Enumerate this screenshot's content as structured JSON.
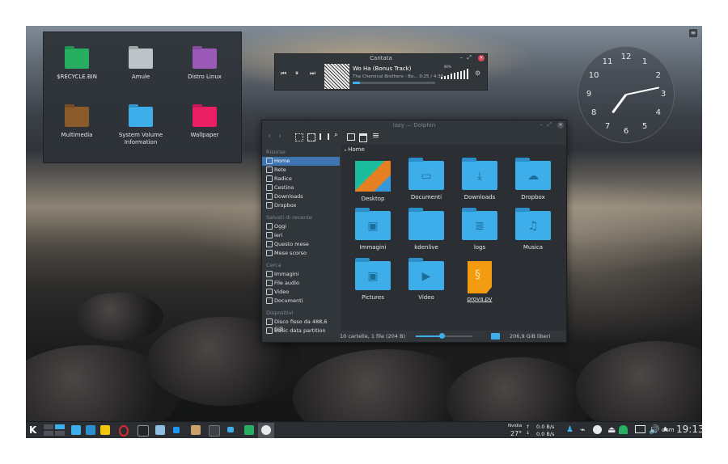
{
  "colors": {
    "accent": "#3daee9",
    "selection": "#3d74b1",
    "panel": "#2a2e32",
    "window": "#31363b"
  },
  "desktop": {
    "menu_icon": "hamburger-icon",
    "folder_view": {
      "items": [
        {
          "label": "$RECYCLE.BIN",
          "color": "#27ae60"
        },
        {
          "label": "Amule",
          "color": "#bdc3c7"
        },
        {
          "label": "Distro Linux",
          "color": "#9b59b6"
        },
        {
          "label": "Multimedia",
          "color": "#8b5a2b"
        },
        {
          "label": "System Volume Information",
          "color": "#3daee9"
        },
        {
          "label": "Wallpaper",
          "color": "#e91e63"
        }
      ]
    }
  },
  "player": {
    "title": "Cantata",
    "track": "Wo Ha (Bonus Track)",
    "artist_time": "The Chemical Brothers - Bo... 0:25 / 4:30",
    "progress": 0.09,
    "volume_label": "80%"
  },
  "clock_widget": {
    "numbers": [
      "12",
      "1",
      "2",
      "3",
      "4",
      "5",
      "6",
      "7",
      "8",
      "9",
      "10",
      "11"
    ],
    "time": "19:13"
  },
  "dolphin": {
    "title": "lazy — Dolphin",
    "crumb": "Home",
    "sidebar": [
      {
        "section": "Risorse",
        "items": [
          "Home",
          "Rete",
          "Radice",
          "Cestino",
          "Downloads",
          "Dropbox"
        ]
      },
      {
        "section": "Salvati di recente",
        "items": [
          "Oggi",
          "Ieri",
          "Questo mese",
          "Mese scorso"
        ]
      },
      {
        "section": "Cerca",
        "items": [
          "Immagini",
          "File audio",
          "Video",
          "Documenti"
        ]
      },
      {
        "section": "Dispositivi",
        "items": [
          "Disco fisso da 488,6 GiB",
          "Basic data partition"
        ]
      }
    ],
    "files": [
      {
        "label": "Desktop",
        "glyph": ""
      },
      {
        "label": "Documenti",
        "glyph": "▭"
      },
      {
        "label": "Downloads",
        "glyph": "⤓"
      },
      {
        "label": "Dropbox",
        "glyph": "☁"
      },
      {
        "label": "Immagini",
        "glyph": "▣"
      },
      {
        "label": "kdenlive",
        "glyph": ""
      },
      {
        "label": "logs",
        "glyph": "≣"
      },
      {
        "label": "Musica",
        "glyph": "♫"
      },
      {
        "label": "Pictures",
        "glyph": "▣"
      },
      {
        "label": "Video",
        "glyph": "▶"
      },
      {
        "label": "prova.py",
        "glyph": "py"
      }
    ],
    "status_left": "10 cartelle, 1 file (204 B)",
    "status_right": "206,9 GiB liberi",
    "zoom": 0.45
  },
  "taskbar": {
    "nvidia_label": "Nvidia",
    "temperature": "27°",
    "net_up": "0.0 B/s",
    "net_down": "0.0 B/s",
    "day": "dom",
    "time": "19:13"
  }
}
